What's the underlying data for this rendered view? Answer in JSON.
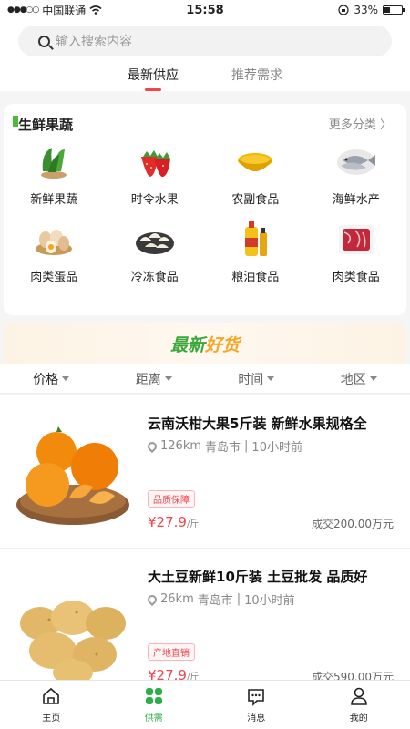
{
  "status_bar": {
    "signal": "●●●○○",
    "carrier": "中国联通",
    "time": "15:58",
    "battery": "33%",
    "battery_level": 0.33
  },
  "search": {
    "placeholder": "输入搜索内容"
  },
  "tabs": [
    {
      "label": "最新供应",
      "active": true
    },
    {
      "label": "推荐需求",
      "active": false
    }
  ],
  "categories": {
    "title": "生鲜果蔬",
    "more": "更多分类 〉",
    "items": [
      {
        "label": "新鲜果蔬",
        "icon": "vegetables-icon"
      },
      {
        "label": "时令水果",
        "icon": "strawberry-icon"
      },
      {
        "label": "农副食品",
        "icon": "grain-bowl-icon"
      },
      {
        "label": "海鲜水产",
        "icon": "fish-icon"
      },
      {
        "label": "肉类蛋品",
        "icon": "eggs-icon"
      },
      {
        "label": "冷冻食品",
        "icon": "dumplings-icon"
      },
      {
        "label": "粮油食品",
        "icon": "oil-bottle-icon"
      },
      {
        "label": "肉类食品",
        "icon": "meat-icon"
      }
    ]
  },
  "banner": {
    "part1": "最新",
    "part2": "好货"
  },
  "filters": [
    {
      "label": "价格",
      "active": true
    },
    {
      "label": "距离",
      "active": false
    },
    {
      "label": "时间",
      "active": false
    },
    {
      "label": "地区",
      "active": false
    }
  ],
  "products": [
    {
      "title": "云南沃柑大果5斤装 新鲜水果规格全",
      "distance": "126km",
      "city": "青岛市",
      "time": "10小时前",
      "tag": "品质保障",
      "price": "¥27.9",
      "unit": "/斤",
      "deal": "成交200.00万元",
      "image": "tangerine-icon"
    },
    {
      "title": "大土豆新鲜10斤装 土豆批发 品质好",
      "distance": "26km",
      "city": "青岛市",
      "time": "10小时前",
      "tag": "产地直销",
      "price": "¥27.9",
      "unit": "/斤",
      "deal": "成交590.00万元",
      "image": "potato-icon"
    }
  ],
  "nav": [
    {
      "label": "主页",
      "icon": "home-icon",
      "active": false
    },
    {
      "label": "供需",
      "icon": "grid-icon",
      "active": true
    },
    {
      "label": "消息",
      "icon": "message-icon",
      "active": false
    },
    {
      "label": "我的",
      "icon": "profile-icon",
      "active": false
    }
  ],
  "colors": {
    "accent_green": "#2eae46",
    "price_red": "#f0444e"
  }
}
